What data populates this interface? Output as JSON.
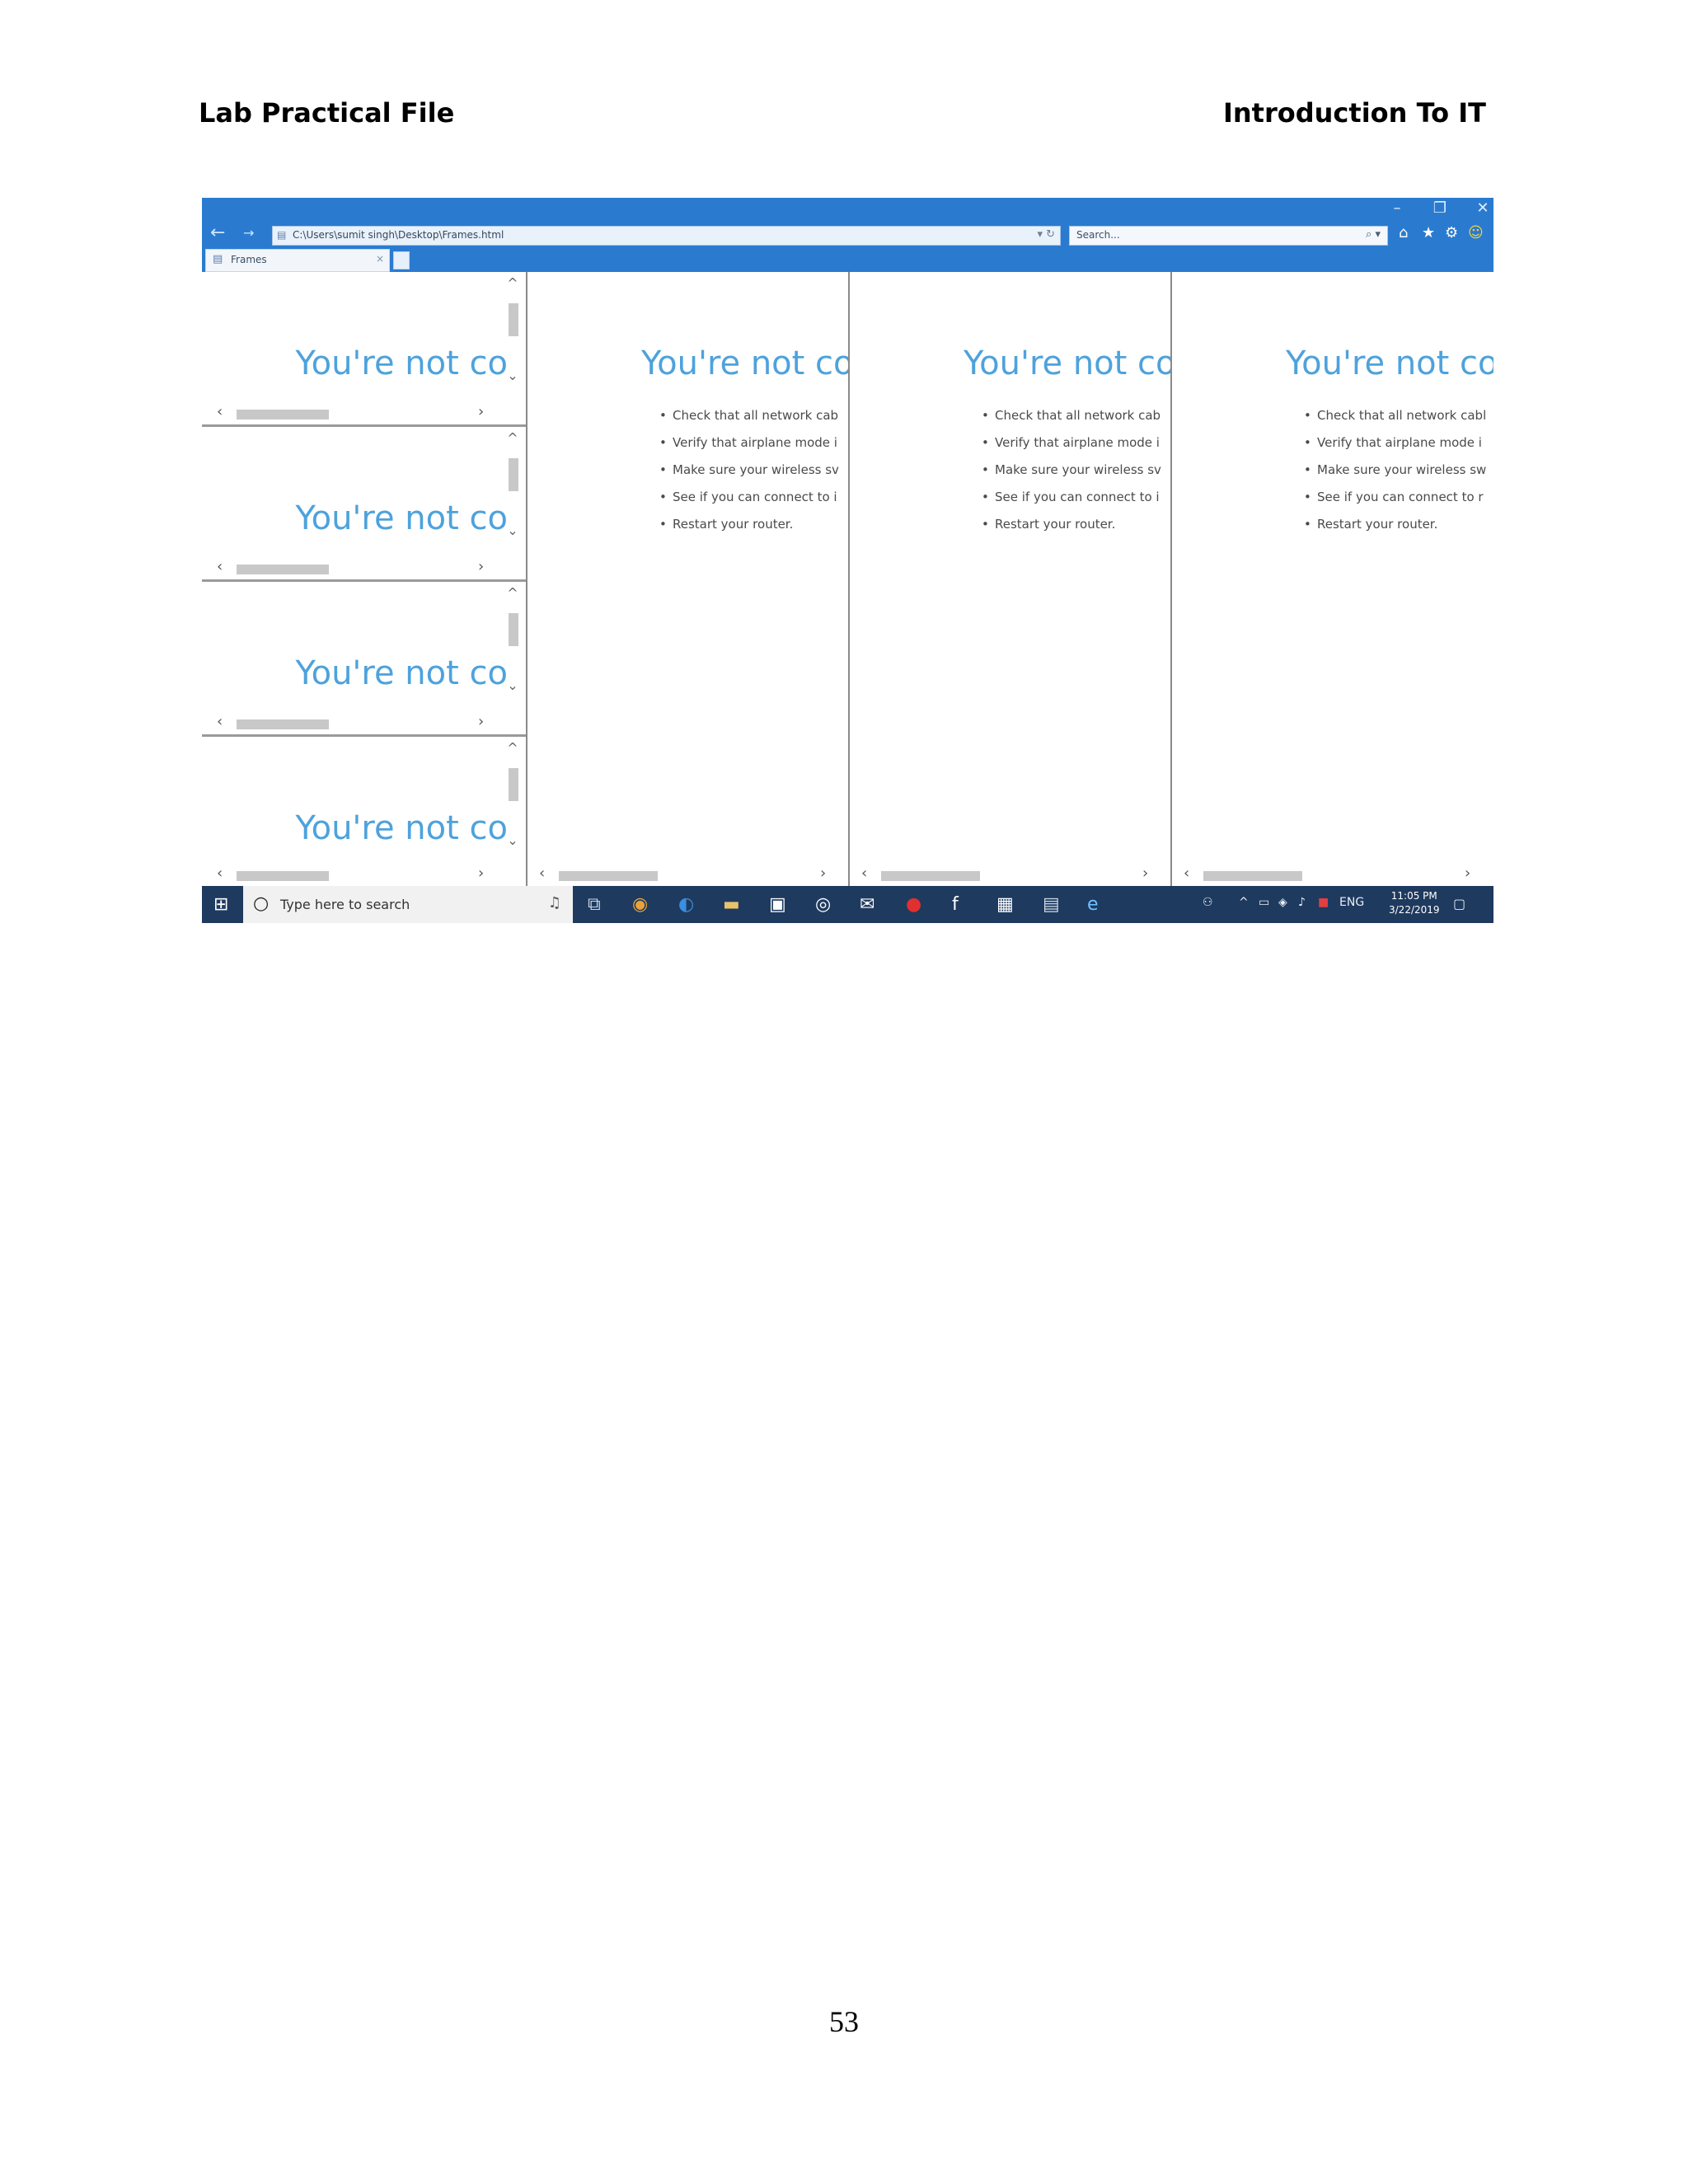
{
  "document": {
    "header_left": "Lab Practical File",
    "header_right": "Introduction To IT",
    "page_number": "53"
  },
  "browser": {
    "window_controls": {
      "minimize": "–",
      "maximize": "❐",
      "close": "✕"
    },
    "nav": {
      "back": "←",
      "forward": "→"
    },
    "address": "C:\\Users\\sumit singh\\Desktop\\Frames.html",
    "address_controls": "▾ ↻",
    "search_placeholder": "Search...",
    "search_controls": "⌕ ▾",
    "tab_label": "Frames",
    "tab_close": "×",
    "toolbar_icons": {
      "home": "⌂",
      "favorites": "★",
      "settings": "⚙",
      "feedback": "☺"
    }
  },
  "left_frames": [
    {
      "message": "You're not co"
    },
    {
      "message": "You're not co"
    },
    {
      "message": "You're not co"
    },
    {
      "message": "You're not co"
    }
  ],
  "right_frames": [
    {
      "message": "You're not cor",
      "bullets": [
        "Check that all network cab",
        "Verify that airplane mode i",
        "Make sure your wireless sv",
        "See if you can connect to i",
        "Restart your router."
      ]
    },
    {
      "message": "You're not cor",
      "bullets": [
        "Check that all network cab",
        "Verify that airplane mode i",
        "Make sure your wireless sv",
        "See if you can connect to i",
        "Restart your router."
      ]
    },
    {
      "message": "You're not con",
      "bullets": [
        "Check that all network cabl",
        "Verify that airplane mode i",
        "Make sure your wireless sw",
        "See if you can connect to r",
        "Restart your router."
      ]
    }
  ],
  "scroll_glyphs": {
    "up": "^",
    "down": "⌄",
    "left": "‹",
    "right": "›"
  },
  "taskbar": {
    "search_text": "Type here to search",
    "tray_text": "ENG",
    "time": "11:05 PM",
    "date": "3/22/2019",
    "colors": {
      "background": "#1f3a5f",
      "titlebar": "#2a7bd0",
      "accent_text": "#4ea2dc"
    }
  }
}
